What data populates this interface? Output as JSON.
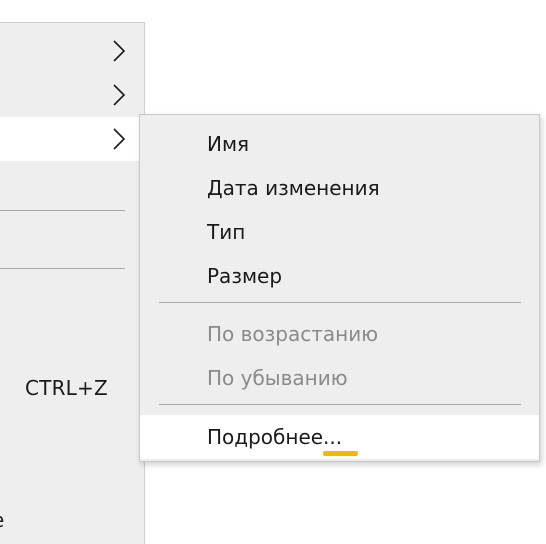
{
  "parent_menu": {
    "submenu_arrows": [
      "chevron-right-icon",
      "chevron-right-icon",
      "chevron-right-icon"
    ],
    "undo_shortcut": "CTRL+Z",
    "clipped_text": "e"
  },
  "sort_submenu": {
    "items": [
      {
        "label": "Имя",
        "enabled": true
      },
      {
        "label": "Дата изменения",
        "enabled": true
      },
      {
        "label": "Тип",
        "enabled": true
      },
      {
        "label": "Размер",
        "enabled": true
      }
    ],
    "order_items": [
      {
        "label": "По возрастанию",
        "enabled": false
      },
      {
        "label": "По убыванию",
        "enabled": false
      }
    ],
    "more": {
      "label": "Подробнее...",
      "hovered": true
    }
  },
  "colors": {
    "menu_background": "#eeeeee",
    "highlight": "#ffffff",
    "separator": "#a9a9a9",
    "disabled_text": "#8a8a8a",
    "focus_accent": "#f2b705"
  }
}
